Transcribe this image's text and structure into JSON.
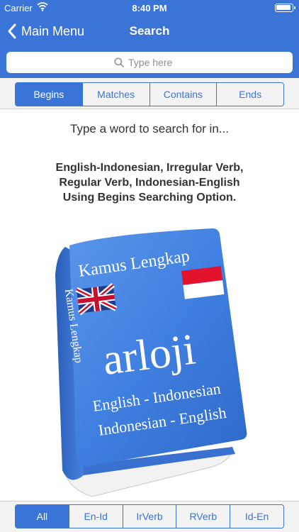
{
  "status": {
    "carrier": "Carrier",
    "time": "8:40 PM"
  },
  "nav": {
    "back_label": "Main Menu",
    "title": "Search"
  },
  "search": {
    "placeholder": "Type here"
  },
  "search_modes": {
    "items": [
      "Begins",
      "Matches",
      "Contains",
      "Ends"
    ],
    "selected": "Begins"
  },
  "prompt": "Type a word to search for in...",
  "description_lines": [
    "English-Indonesian, Irregular Verb,",
    "Regular Verb, Indonesian-English",
    "Using Begins Searching Option."
  ],
  "book": {
    "title": "Kamus Lengkap",
    "spine": "Kamus Lengkap",
    "brand": "arloji",
    "line1": "English - Indonesian",
    "line2": "Indonesian - English"
  },
  "dictionaries": {
    "items": [
      "All",
      "En-Id",
      "IrVerb",
      "RVerb",
      "Id-En"
    ],
    "selected": "All"
  },
  "colors": {
    "accent": "#3a74d6",
    "bar_bg": "#f3f3f3",
    "book_blue": "#3f7fe0"
  }
}
